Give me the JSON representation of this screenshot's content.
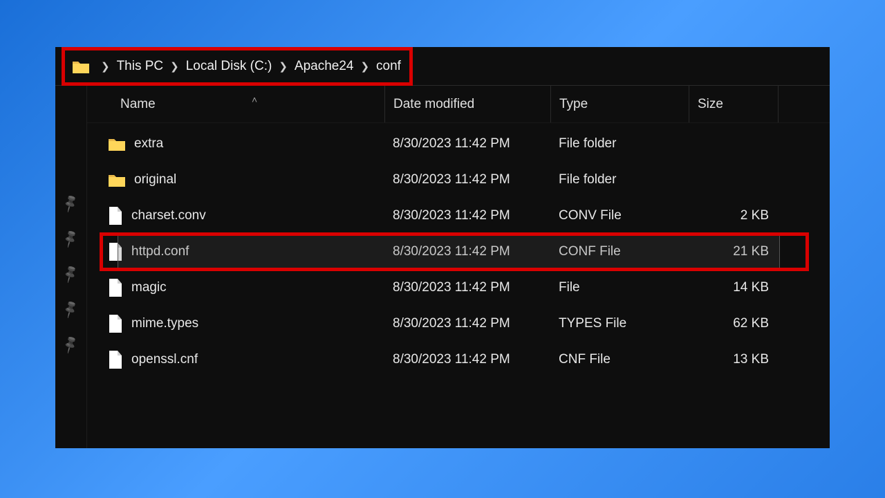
{
  "breadcrumb": {
    "items": [
      "This PC",
      "Local Disk (C:)",
      "Apache24",
      "conf"
    ]
  },
  "columns": {
    "name": "Name",
    "date": "Date modified",
    "type": "Type",
    "size": "Size"
  },
  "rows": [
    {
      "icon": "folder",
      "name": "extra",
      "date": "8/30/2023 11:42 PM",
      "type": "File folder",
      "size": "",
      "highlight": false
    },
    {
      "icon": "folder",
      "name": "original",
      "date": "8/30/2023 11:42 PM",
      "type": "File folder",
      "size": "",
      "highlight": false
    },
    {
      "icon": "file",
      "name": "charset.conv",
      "date": "8/30/2023 11:42 PM",
      "type": "CONV File",
      "size": "2 KB",
      "highlight": false
    },
    {
      "icon": "file",
      "name": "httpd.conf",
      "date": "8/30/2023 11:42 PM",
      "type": "CONF File",
      "size": "21 KB",
      "highlight": true
    },
    {
      "icon": "file",
      "name": "magic",
      "date": "8/30/2023 11:42 PM",
      "type": "File",
      "size": "14 KB",
      "highlight": false
    },
    {
      "icon": "file",
      "name": "mime.types",
      "date": "8/30/2023 11:42 PM",
      "type": "TYPES File",
      "size": "62 KB",
      "highlight": false
    },
    {
      "icon": "file",
      "name": "openssl.cnf",
      "date": "8/30/2023 11:42 PM",
      "type": "CNF File",
      "size": "13 KB",
      "highlight": false
    }
  ],
  "sidebar_pin_count": 5
}
